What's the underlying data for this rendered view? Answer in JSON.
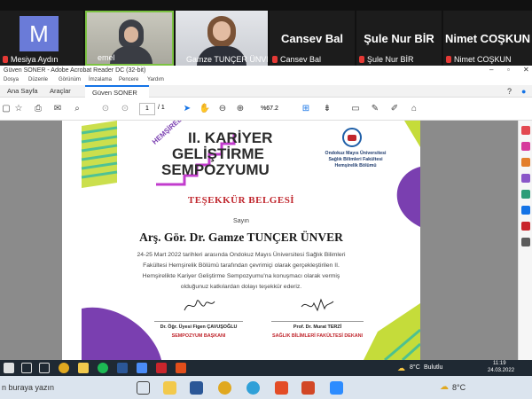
{
  "zoom_gallery": {
    "participants": [
      {
        "name": "Mesiya Aydın",
        "initial": "M"
      },
      {
        "name": "emel"
      },
      {
        "name": "Gamze TUNÇER ÜNVER"
      },
      {
        "name": "Cansev Bal"
      },
      {
        "name": "Şule Nur BİR"
      },
      {
        "name": "Nimet COŞKUN"
      }
    ]
  },
  "acrobat": {
    "window_title": "Güven SONER - Adobe Acrobat Reader DC (32-bit)",
    "menu": [
      "Dosya",
      "Düzenle",
      "Görünüm",
      "İmzalama",
      "Pencere",
      "Yardım"
    ],
    "tabs": [
      "Ana Sayfa",
      "Araçlar",
      "Güven SONER"
    ],
    "page_current": "1",
    "page_total": "/ 1",
    "zoom": "%67.2"
  },
  "certificate": {
    "event_prefix": "HEMŞİRELİKTE",
    "event_title_1": "II. KARİYER",
    "event_title_2": "GELİŞTİRME",
    "event_title_3": "SEMPOZYUMU",
    "university_1": "Ondokuz Mayıs Üniversitesi",
    "university_2": "Sağlık Bilimleri Fakültesi",
    "university_3": "Hemşirelik Bölümü",
    "heading": "TEŞEKKÜR BELGESİ",
    "salutation": "Sayın",
    "recipient": "Arş. Gör. Dr. Gamze TUNÇER ÜNVER",
    "body_line1": "24-25 Mart 2022 tarihleri arasında Ondokuz Mayıs Üniversitesi Sağlık Bilimleri",
    "body_line2": "Fakültesi Hemşirelik Bölümü tarafından çevrimiçi olarak gerçekleştirilen II.",
    "body_line3": "Hemşirelikte Kariyer Geliştirme Sempozyumu'na konuşmacı olarak vermiş",
    "body_line4": "olduğunuz katkılardan dolayı teşekkür ederiz.",
    "signer1_name": "Dr. Öğr. Üyesi Figen ÇAVUŞOĞLU",
    "signer1_title": "SEMPOZYUM BAŞKANI",
    "signer2_name": "Prof. Dr. Murat TERZİ",
    "signer2_title": "SAĞLIK BİLİMLERİ FAKÜLTESİ DEKANI"
  },
  "taskbar": {
    "weather_temp": "8°C",
    "weather_text": "Bulutlu",
    "time": "11:19",
    "date": "24.03.2022",
    "search_placeholder": "n buraya yazın",
    "weather_temp2": "8°C"
  },
  "colors": {
    "accent_purple": "#7a3fb0",
    "accent_pink": "#d63384",
    "accent_green": "#c5dc3a",
    "accent_teal": "#1bb7b3",
    "heading_red": "#c0262d"
  }
}
